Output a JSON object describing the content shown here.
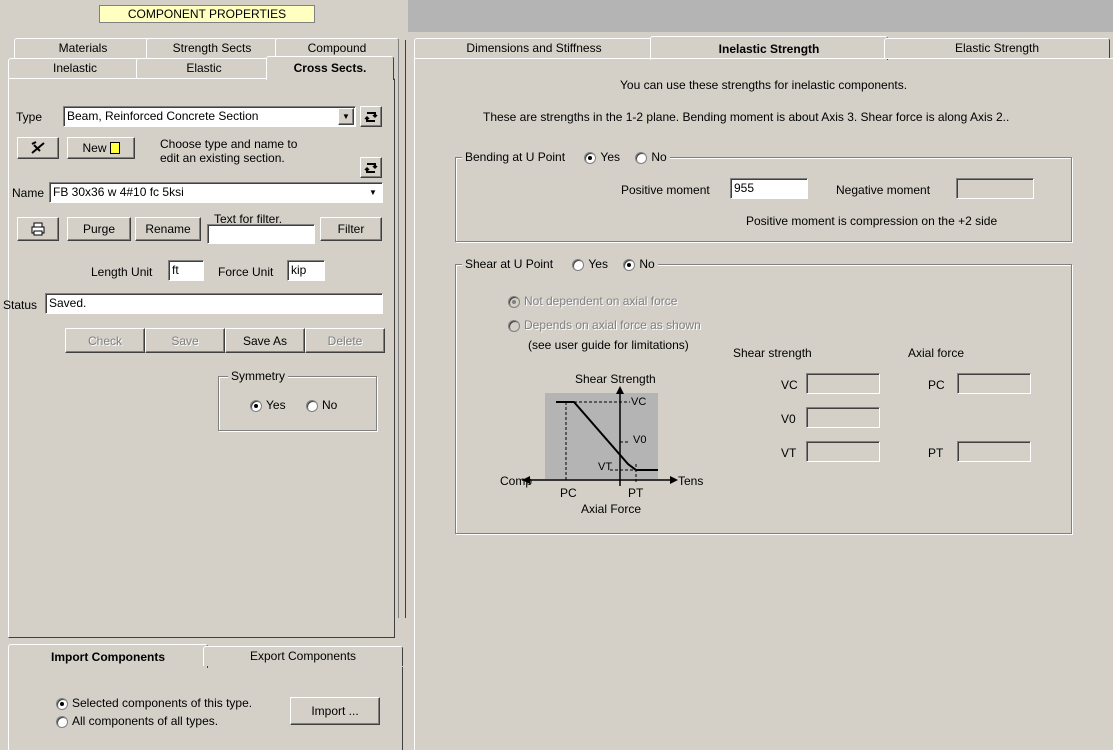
{
  "header": {
    "title": "COMPONENT PROPERTIES"
  },
  "left_tabs_row1": [
    "Materials",
    "Strength Sects",
    "Compound"
  ],
  "left_tabs_row2": [
    "Inelastic",
    "Elastic",
    "Cross Sects."
  ],
  "type_row": {
    "label": "Type",
    "value": "Beam, Reinforced Concrete Section"
  },
  "new_row": {
    "new_label": "New",
    "hint": "Choose type and name to edit an existing section."
  },
  "name_row": {
    "label": "Name",
    "value": "FB 30x36 w 4#10 fc 5ksi"
  },
  "action_row": {
    "purge": "Purge",
    "rename": "Rename",
    "filter_hint": "Text for filter.",
    "filter_value": "",
    "filter_btn": "Filter"
  },
  "units": {
    "length_label": "Length Unit",
    "length_value": "ft",
    "force_label": "Force Unit",
    "force_value": "kip"
  },
  "status": {
    "label": "Status",
    "value": "Saved."
  },
  "buttons": {
    "check": "Check",
    "save": "Save",
    "save_as": "Save As",
    "delete": "Delete"
  },
  "symmetry": {
    "title": "Symmetry",
    "yes": "Yes",
    "no": "No",
    "selected": "Yes"
  },
  "bottom_tabs": [
    "Import Components",
    "Export Components"
  ],
  "import": {
    "option1": "Selected components of this type.",
    "option2": "All components of all types.",
    "button": "Import ..."
  },
  "right_tabs": [
    "Dimensions and Stiffness",
    "Inelastic Strength",
    "Elastic Strength"
  ],
  "right": {
    "intro1": "You can use these strengths for inelastic components.",
    "intro2": "These are strengths in the 1-2 plane. Bending moment is about Axis 3. Shear force is along Axis 2..",
    "bending": {
      "title": "Bending at U Point",
      "yes": "Yes",
      "no": "No",
      "pos_label": "Positive moment",
      "pos_value": "955",
      "neg_label": "Negative moment",
      "neg_value": "",
      "note": "Positive moment is compression on the +2 side"
    },
    "shear": {
      "title": "Shear at U Point",
      "yes": "Yes",
      "no": "No",
      "opt1": "Not dependent on axial force",
      "opt2": "Depends on axial force as shown",
      "opt2_note": "(see user guide for limitations)",
      "col1": "Shear strength",
      "col2": "Axial force",
      "vc": "VC",
      "v0": "V0",
      "vt": "VT",
      "pc": "PC",
      "pt": "PT",
      "diagram": {
        "title": "Shear Strength",
        "xlabel": "Axial Force",
        "comp": "Comp",
        "tens": "Tens",
        "vc": "VC",
        "v0": "V0",
        "vt": "VT",
        "pc": "PC",
        "pt": "PT"
      }
    }
  }
}
